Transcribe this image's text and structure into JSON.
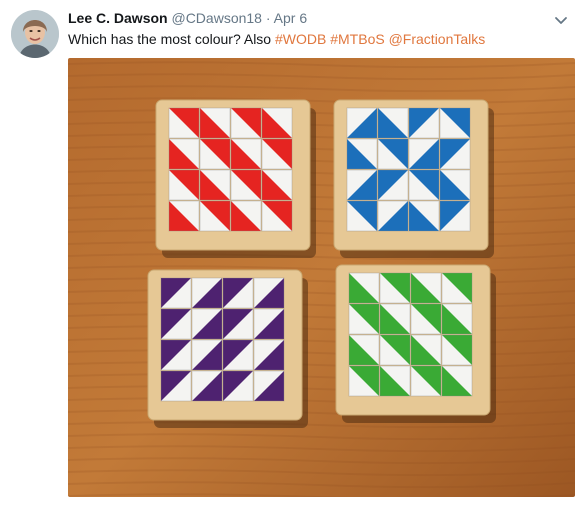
{
  "tweet": {
    "author_name": "Lee C. Dawson",
    "handle": "@CDawson18",
    "separator": "·",
    "date": "Apr 6",
    "text": "Which has the most colour? Also ",
    "tags": [
      "#WODB",
      "#MTBoS",
      "@FractionTalks"
    ],
    "link_color": "#e0773e"
  },
  "photo": {
    "boards": [
      {
        "name": "red-board",
        "color": "#e52421"
      },
      {
        "name": "blue-board",
        "color": "#1c6fba"
      },
      {
        "name": "purple-board",
        "color": "#4e2270"
      },
      {
        "name": "green-board",
        "color": "#3aaa35"
      }
    ]
  }
}
